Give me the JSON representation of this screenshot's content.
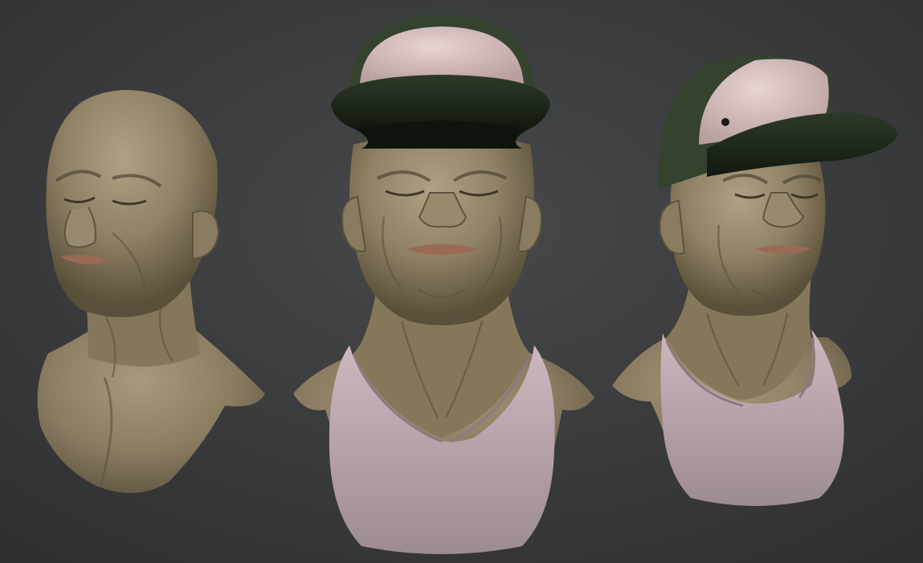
{
  "scene": {
    "background_color": "#3b3c3e",
    "background_highlight": "#4a4b4d",
    "busts": [
      {
        "id": "bust-bald",
        "view": "three-quarter-left",
        "has_cap": false,
        "has_tank_top": false
      },
      {
        "id": "bust-front",
        "view": "front",
        "has_cap": true,
        "has_tank_top": true
      },
      {
        "id": "bust-right",
        "view": "three-quarter-right",
        "has_cap": true,
        "has_tank_top": true
      }
    ]
  },
  "colors": {
    "skin": "#8f8165",
    "skin_light": "#a89a7c",
    "skin_shadow": "#5e5440",
    "lips": "#9a6a55",
    "cap_crown": "#d9c1c0",
    "cap_brim": "#1f2a1c",
    "cap_side": "#34422e",
    "tank_top": "#bfaab2",
    "tank_top_shadow": "#9d8b93"
  }
}
